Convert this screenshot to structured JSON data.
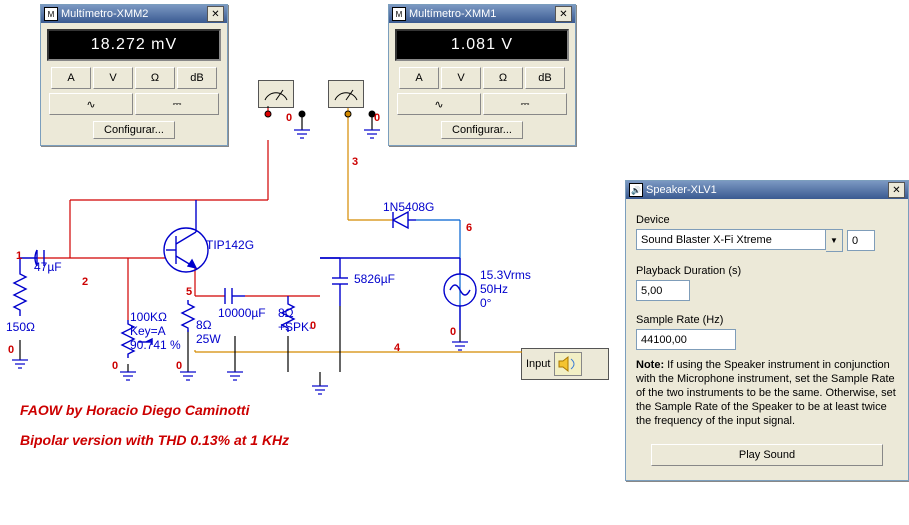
{
  "multimeter2": {
    "title": "Multímetro-XMM2",
    "reading": "18.272 mV",
    "buttons": {
      "a": "A",
      "v": "V",
      "ohm": "Ω",
      "db": "dB"
    },
    "wave": {
      "sine": "∿",
      "dc": "⎓"
    },
    "config": "Configurar..."
  },
  "multimeter1": {
    "title": "Multímetro-XMM1",
    "reading": "1.081 V",
    "buttons": {
      "a": "A",
      "v": "V",
      "ohm": "Ω",
      "db": "dB"
    },
    "wave": {
      "sine": "∿",
      "dc": "⎓"
    },
    "config": "Configurar..."
  },
  "speaker": {
    "title": "Speaker-XLV1",
    "device_label": "Device",
    "device_value": "Sound Blaster X-Fi Xtreme",
    "device_aux": "0",
    "duration_label": "Playback Duration (s)",
    "duration_value": "5,00",
    "rate_label": "Sample Rate (Hz)",
    "rate_value": "44100,00",
    "note_prefix": "Note:",
    "note_text": " If using the Speaker instrument in conjunction with the Microphone instrument, set the Sample Rate of the two instruments to be the same. Otherwise, set the Sample Rate of the Speaker to be at least twice the frequency of the input signal.",
    "play": "Play Sound"
  },
  "schematic": {
    "transistor": "TIP142G",
    "diode": "1N5408G",
    "c_in": "47µF",
    "r_in": "150Ω",
    "pot": "100KΩ\nKey=A\n90.741 %",
    "r_load": "8Ω\n25W",
    "c_big": "10000µF",
    "spk_load": "8Ω\n+SPK-",
    "c_filter": "5826µF",
    "vsrc": "15.3Vrms\n50Hz\n0°",
    "input_label": "Input",
    "credit1": "FAOW by Horacio Diego Caminotti",
    "credit2": "Bipolar version with THD 0.13% at 1 KHz",
    "nodes": {
      "n0a": "0",
      "n0b": "0",
      "n0c": "0",
      "n0d": "0",
      "n0e": "0",
      "n0f": "0",
      "n0g": "0",
      "n1": "1",
      "n2": "2",
      "n3": "3",
      "n4": "4",
      "n5": "5",
      "n6": "6"
    }
  }
}
